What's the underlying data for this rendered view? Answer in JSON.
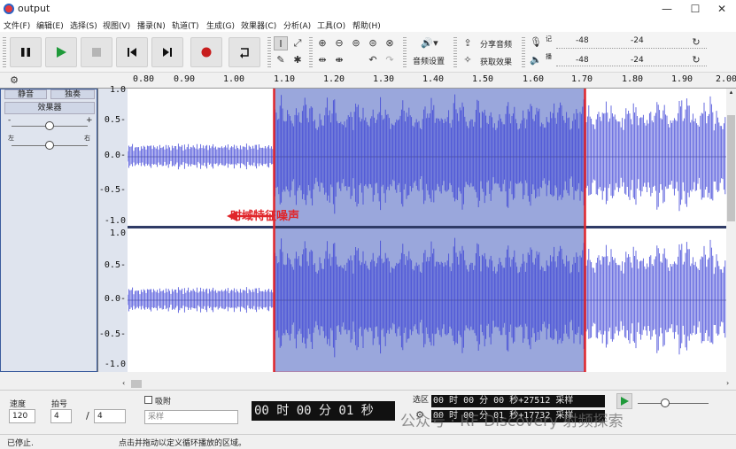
{
  "window": {
    "title": "output",
    "minimize": "—",
    "maximize": "☐",
    "close": "✕"
  },
  "menu": [
    "文件(F)",
    "编辑(E)",
    "选择(S)",
    "视图(V)",
    "播录(N)",
    "轨道(T)",
    "生成(G)",
    "效果器(C)",
    "分析(A)",
    "工具(O)",
    "帮助(H)"
  ],
  "toolbar": {
    "audio_setup": "音频设置",
    "share_audio": "分享音频",
    "get_effects": "获取效果",
    "meter_r": "记",
    "meter_p": "播",
    "meter_ticks": [
      "-48",
      "-24"
    ],
    "meter_ticks2": [
      "-48",
      "-24"
    ]
  },
  "ruler": {
    "ticks": [
      "0.80",
      "0.90",
      "1.00",
      "1.10",
      "1.20",
      "1.30",
      "1.40",
      "1.50",
      "1.60",
      "1.70",
      "1.80",
      "1.90",
      "2.00"
    ]
  },
  "track": {
    "mute": "静音",
    "solo": "独奏",
    "effects": "效果器",
    "gain_minus": "-",
    "gain_plus": "+",
    "pan_left": "左",
    "pan_right": "右"
  },
  "scale": {
    "top": [
      "1.0",
      "0.5-",
      "0.0-",
      "-0.5-",
      "-1.0"
    ],
    "bottom": [
      "1.0",
      "0.5-",
      "0.0-",
      "-0.5-",
      "-1.0"
    ]
  },
  "annotation": {
    "text": "时域特征噪声",
    "color": "#e0262b"
  },
  "bottom": {
    "tempo_label": "速度",
    "tempo_value": "120",
    "meter_label": "拍号",
    "meter_num": "4",
    "meter_den": "4",
    "snap_label": "吸附",
    "snap_value": "采样",
    "time_display": "00 时 00 分 01 秒",
    "selection_label": "选区",
    "sel_start": "00 时 00 分 00 秒+27512 采样",
    "sel_end": "00 时 00 分 01 秒+17732 采样"
  },
  "status": {
    "left": "已停止.",
    "hint": "点击并拖动以定义循环播放的区域。"
  },
  "watermark": "公众号 · RF Discovery 射频探索",
  "colors": {
    "selection": "#9aa7dc",
    "wave": "#3a3fd6",
    "accent": "#e0262b"
  }
}
